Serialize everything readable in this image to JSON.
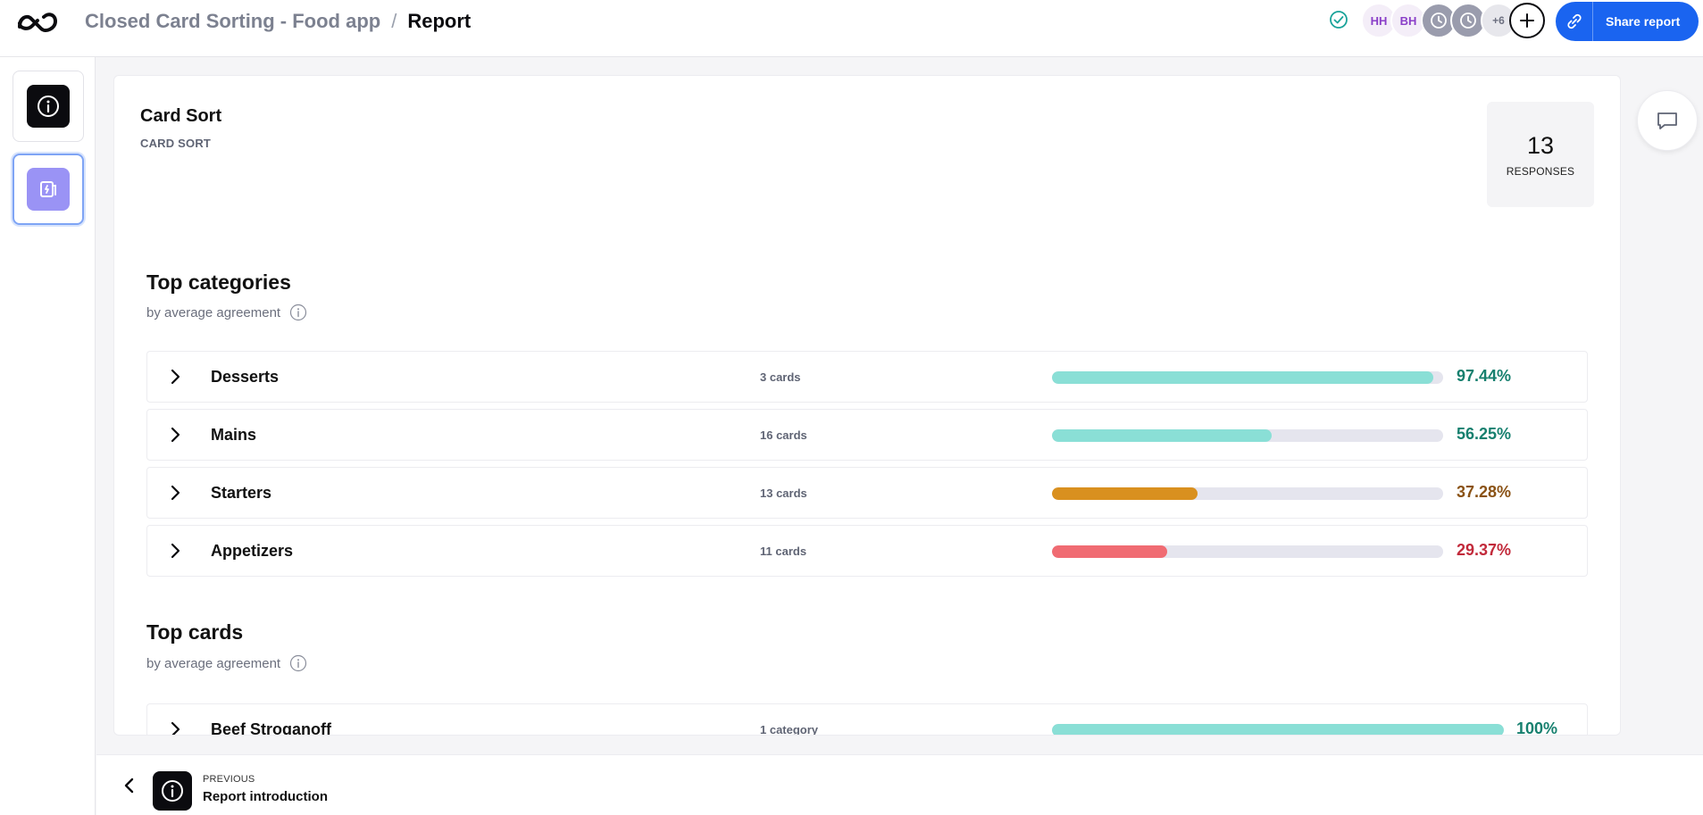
{
  "header": {
    "project_title": "Closed Card Sorting - Food app",
    "separator": "/",
    "current_page": "Report",
    "collaborators": [
      {
        "initials": "HH",
        "kind": "initials"
      },
      {
        "initials": "BH",
        "kind": "initials"
      },
      {
        "initials": "",
        "kind": "pending"
      },
      {
        "initials": "",
        "kind": "pending"
      }
    ],
    "more_count": "+6",
    "share_label": "Share report"
  },
  "rail": {
    "items": [
      {
        "icon": "info-icon",
        "active": false
      },
      {
        "icon": "card-sort-icon",
        "active": true
      }
    ]
  },
  "section": {
    "title": "Card Sort",
    "type_label": "CARD SORT",
    "responses_count": "13",
    "responses_label": "RESPONSES"
  },
  "top_categories": {
    "heading": "Top categories",
    "subheading": "by average agreement",
    "rows": [
      {
        "name": "Desserts",
        "count": "3 cards",
        "agreement": 97.44,
        "pct_label": "97.44%",
        "bar_color": "#8adfd6",
        "text_color": "#17806f"
      },
      {
        "name": "Mains",
        "count": "16 cards",
        "agreement": 56.25,
        "pct_label": "56.25%",
        "bar_color": "#8adfd6",
        "text_color": "#17806f"
      },
      {
        "name": "Starters",
        "count": "13 cards",
        "agreement": 37.28,
        "pct_label": "37.28%",
        "bar_color": "#d9901f",
        "text_color": "#8a5215"
      },
      {
        "name": "Appetizers",
        "count": "11 cards",
        "agreement": 29.37,
        "pct_label": "29.37%",
        "bar_color": "#f06b72",
        "text_color": "#c22a3b"
      }
    ]
  },
  "top_cards": {
    "heading": "Top cards",
    "subheading": "by average agreement",
    "rows": [
      {
        "name": "Beef Stroganoff",
        "count": "1 category",
        "agreement": 100,
        "pct_label": "100%",
        "bar_color": "#8adfd6",
        "text_color": "#17806f"
      }
    ]
  },
  "footer": {
    "kicker": "PREVIOUS",
    "title": "Report introduction"
  },
  "colors": {
    "brand_blue": "#1a64f0",
    "teal": "#17806f",
    "violet": "#9a93f5"
  }
}
